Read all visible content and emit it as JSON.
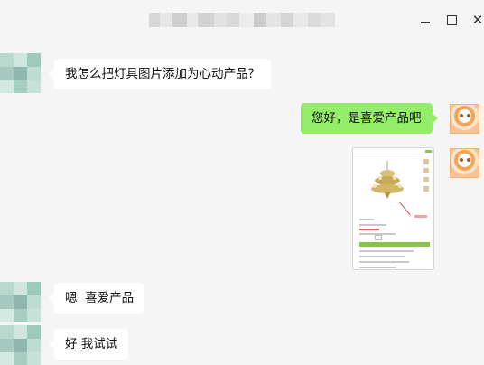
{
  "window": {
    "controls": [
      "minimize-icon",
      "maximize-icon",
      "close-icon"
    ],
    "close_glyph": "✕"
  },
  "messages": [
    {
      "side": "left",
      "text": "我怎么把灯具图片添加为心动产品？"
    },
    {
      "side": "right",
      "text": "您好，是喜爱产品吧"
    },
    {
      "side": "right",
      "type": "image",
      "icon": "product-page-screenshot"
    },
    {
      "side": "left",
      "text": "嗯  喜爱产品"
    },
    {
      "side": "left",
      "text": "好 我试试"
    }
  ],
  "colors": {
    "background": "#f5f5f5",
    "bubble_self": "#95ec69",
    "bubble_other": "#ffffff"
  }
}
